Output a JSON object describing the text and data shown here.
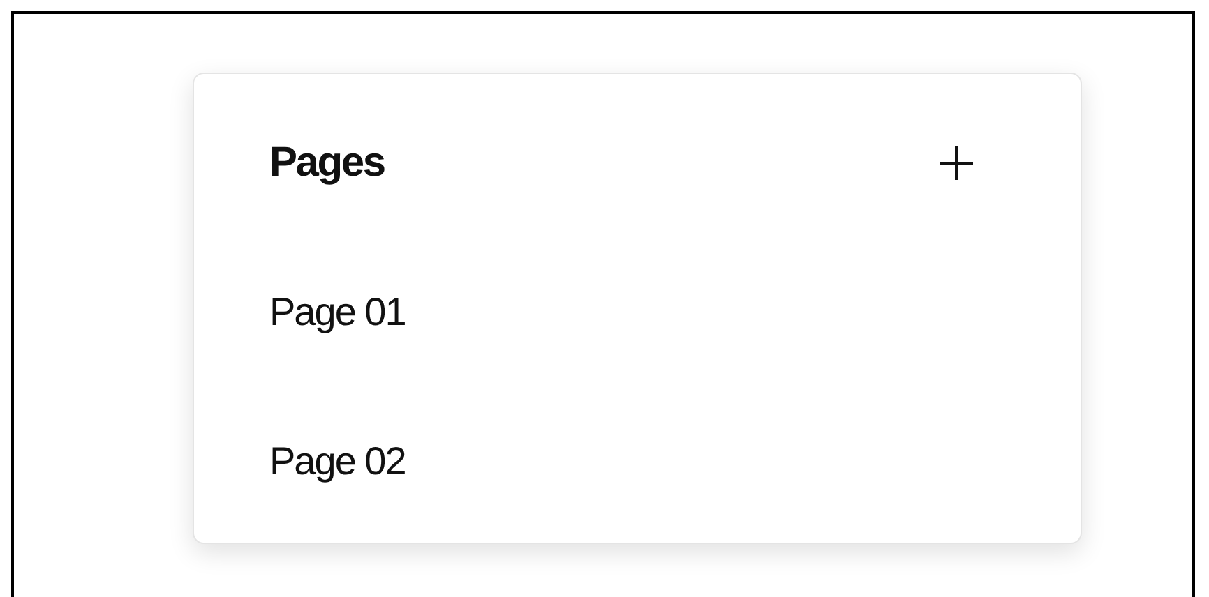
{
  "panel": {
    "title": "Pages",
    "pages": [
      {
        "label": "Page 01"
      },
      {
        "label": "Page 02"
      }
    ]
  }
}
